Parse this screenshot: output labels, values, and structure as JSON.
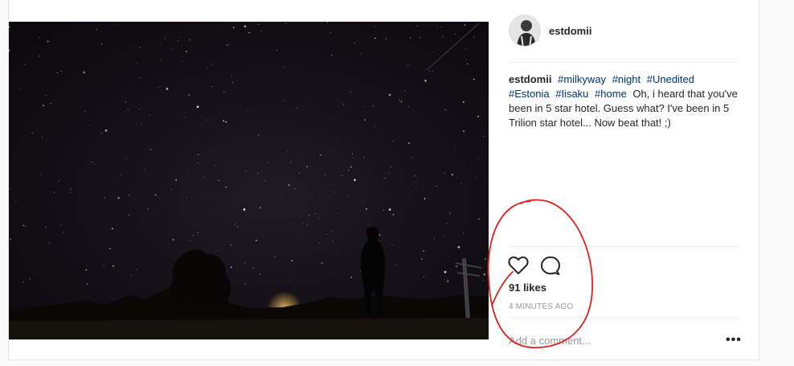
{
  "post": {
    "username": "estdomii",
    "caption": {
      "username": "estdomii",
      "hashtags": [
        "#milkyway",
        "#night",
        "#Unedited",
        "#Estonia",
        "#Iisaku",
        "#home"
      ],
      "text": "Oh, i heard that you've been in 5 star hotel. Guess what? I've been in 5 Trilion star hotel... Now beat that! ;)"
    },
    "likes": "91 likes",
    "timestamp": "4 MINUTES AGO",
    "comment_placeholder": "Add a comment...",
    "more_label": "•••"
  },
  "icons": {
    "like": "heart-icon",
    "comment": "comment-bubble-icon",
    "more": "more-options-icon"
  },
  "colors": {
    "hashtag": "#003569",
    "annotation": "#e0201b",
    "text": "#262626",
    "muted": "#999999"
  }
}
